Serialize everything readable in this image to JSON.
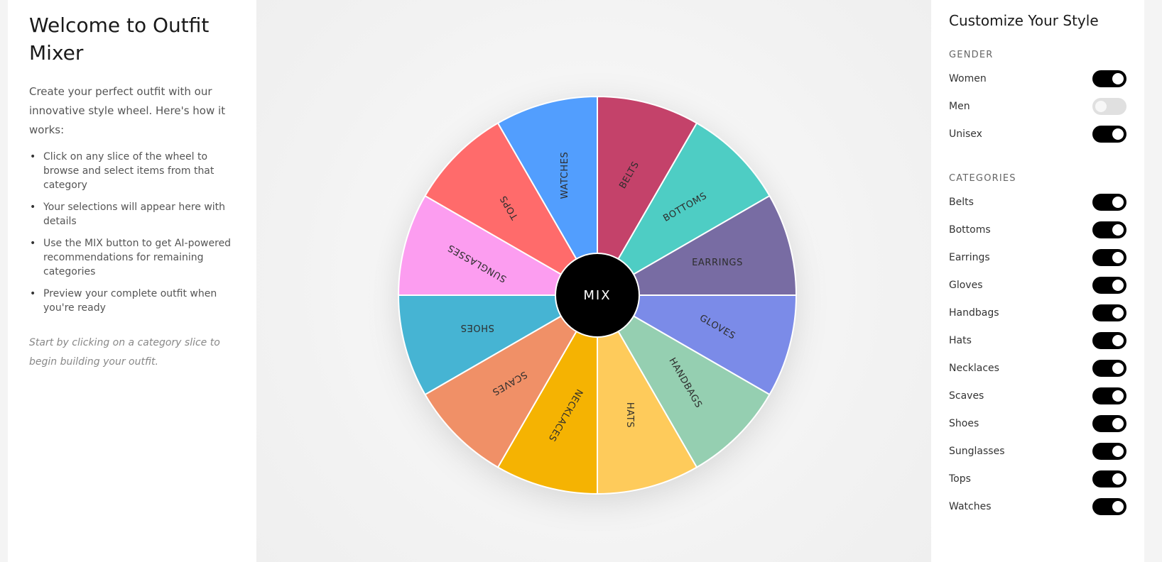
{
  "intro_panel": {
    "title": "Welcome to Outfit Mixer",
    "description": "Create your perfect outfit with our innovative style wheel. Here's how it works:",
    "steps": [
      "Click on any slice of the wheel to browse and select items from that category",
      "Your selections will appear here with details",
      "Use the MIX button to get AI-powered recommendations for remaining categories",
      "Preview your complete outfit when you're ready"
    ],
    "hint": "Start by clicking on a category slice to begin building your outfit."
  },
  "wheel": {
    "mix_label": "MIX",
    "slices": [
      {
        "label": "BELTS",
        "color": "#c4426a"
      },
      {
        "label": "BOTTOMS",
        "color": "#4ecdc4"
      },
      {
        "label": "EARRINGS",
        "color": "#786ca3"
      },
      {
        "label": "GLOVES",
        "color": "#7b8be8"
      },
      {
        "label": "HANDBAGS",
        "color": "#95cfb1"
      },
      {
        "label": "HATS",
        "color": "#fecb5b"
      },
      {
        "label": "NECKLACES",
        "color": "#f5b302"
      },
      {
        "label": "SCAVES",
        "color": "#f09067"
      },
      {
        "label": "SHOES",
        "color": "#46b4d3"
      },
      {
        "label": "SUNGLASSES",
        "color": "#fc9df0"
      },
      {
        "label": "TOPS",
        "color": "#ff6b6b"
      },
      {
        "label": "WATCHES",
        "color": "#529efe"
      }
    ]
  },
  "customize_panel": {
    "title": "Customize Your Style",
    "gender_heading": "GENDER",
    "genders": [
      {
        "label": "Women",
        "on": true
      },
      {
        "label": "Men",
        "on": false
      },
      {
        "label": "Unisex",
        "on": true
      }
    ],
    "categories_heading": "CATEGORIES",
    "categories": [
      {
        "label": "Belts",
        "on": true
      },
      {
        "label": "Bottoms",
        "on": true
      },
      {
        "label": "Earrings",
        "on": true
      },
      {
        "label": "Gloves",
        "on": true
      },
      {
        "label": "Handbags",
        "on": true
      },
      {
        "label": "Hats",
        "on": true
      },
      {
        "label": "Necklaces",
        "on": true
      },
      {
        "label": "Scaves",
        "on": true
      },
      {
        "label": "Shoes",
        "on": true
      },
      {
        "label": "Sunglasses",
        "on": true
      },
      {
        "label": "Tops",
        "on": true
      },
      {
        "label": "Watches",
        "on": true
      }
    ]
  }
}
